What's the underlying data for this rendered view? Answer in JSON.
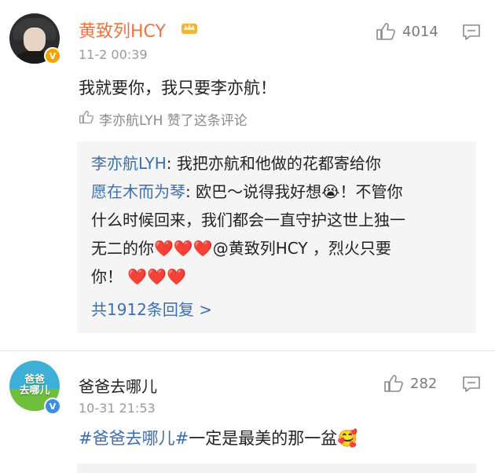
{
  "comments": [
    {
      "username": "黄致列HCY",
      "timestamp": "11-2 00:39",
      "text": "我就要你，我只要李亦航！",
      "likes": "4014",
      "liked_by": "李亦航LYH 赞了这条评论",
      "replies": [
        {
          "name": "李亦航LYH",
          "text": ": 我把亦航和他做的花都寄给你"
        },
        {
          "name": "愿在木而为琴",
          "text": ": 欧巴～说得我好想😭！不管你"
        },
        {
          "name": "",
          "text": "什么时候回来，我们都会一直守护这世上独一"
        },
        {
          "name": "",
          "text": "无二的你❤️❤️❤️@黄致列HCY ，烈火只要"
        },
        {
          "name": "",
          "text": "你！ ❤️❤️❤️"
        }
      ],
      "more_replies": "共1912条回复 >"
    },
    {
      "username": "爸爸去哪儿",
      "timestamp": "10-31 21:53",
      "hashtag": "#爸爸去哪儿#",
      "text_after": "一定是最美的那一盆🥰",
      "likes": "282",
      "avatar_text": "爸爸\n去哪儿"
    }
  ],
  "icons": {
    "like": "thumbs-up-icon",
    "comment": "comment-icon",
    "verified": "verified-badge-icon",
    "crown": "crown-badge-icon"
  },
  "colors": {
    "username_orange": "#eb7340",
    "link_blue": "#3b6fb4",
    "verified_gold": "#f4a300",
    "verified_blue": "#3b8ee8"
  }
}
